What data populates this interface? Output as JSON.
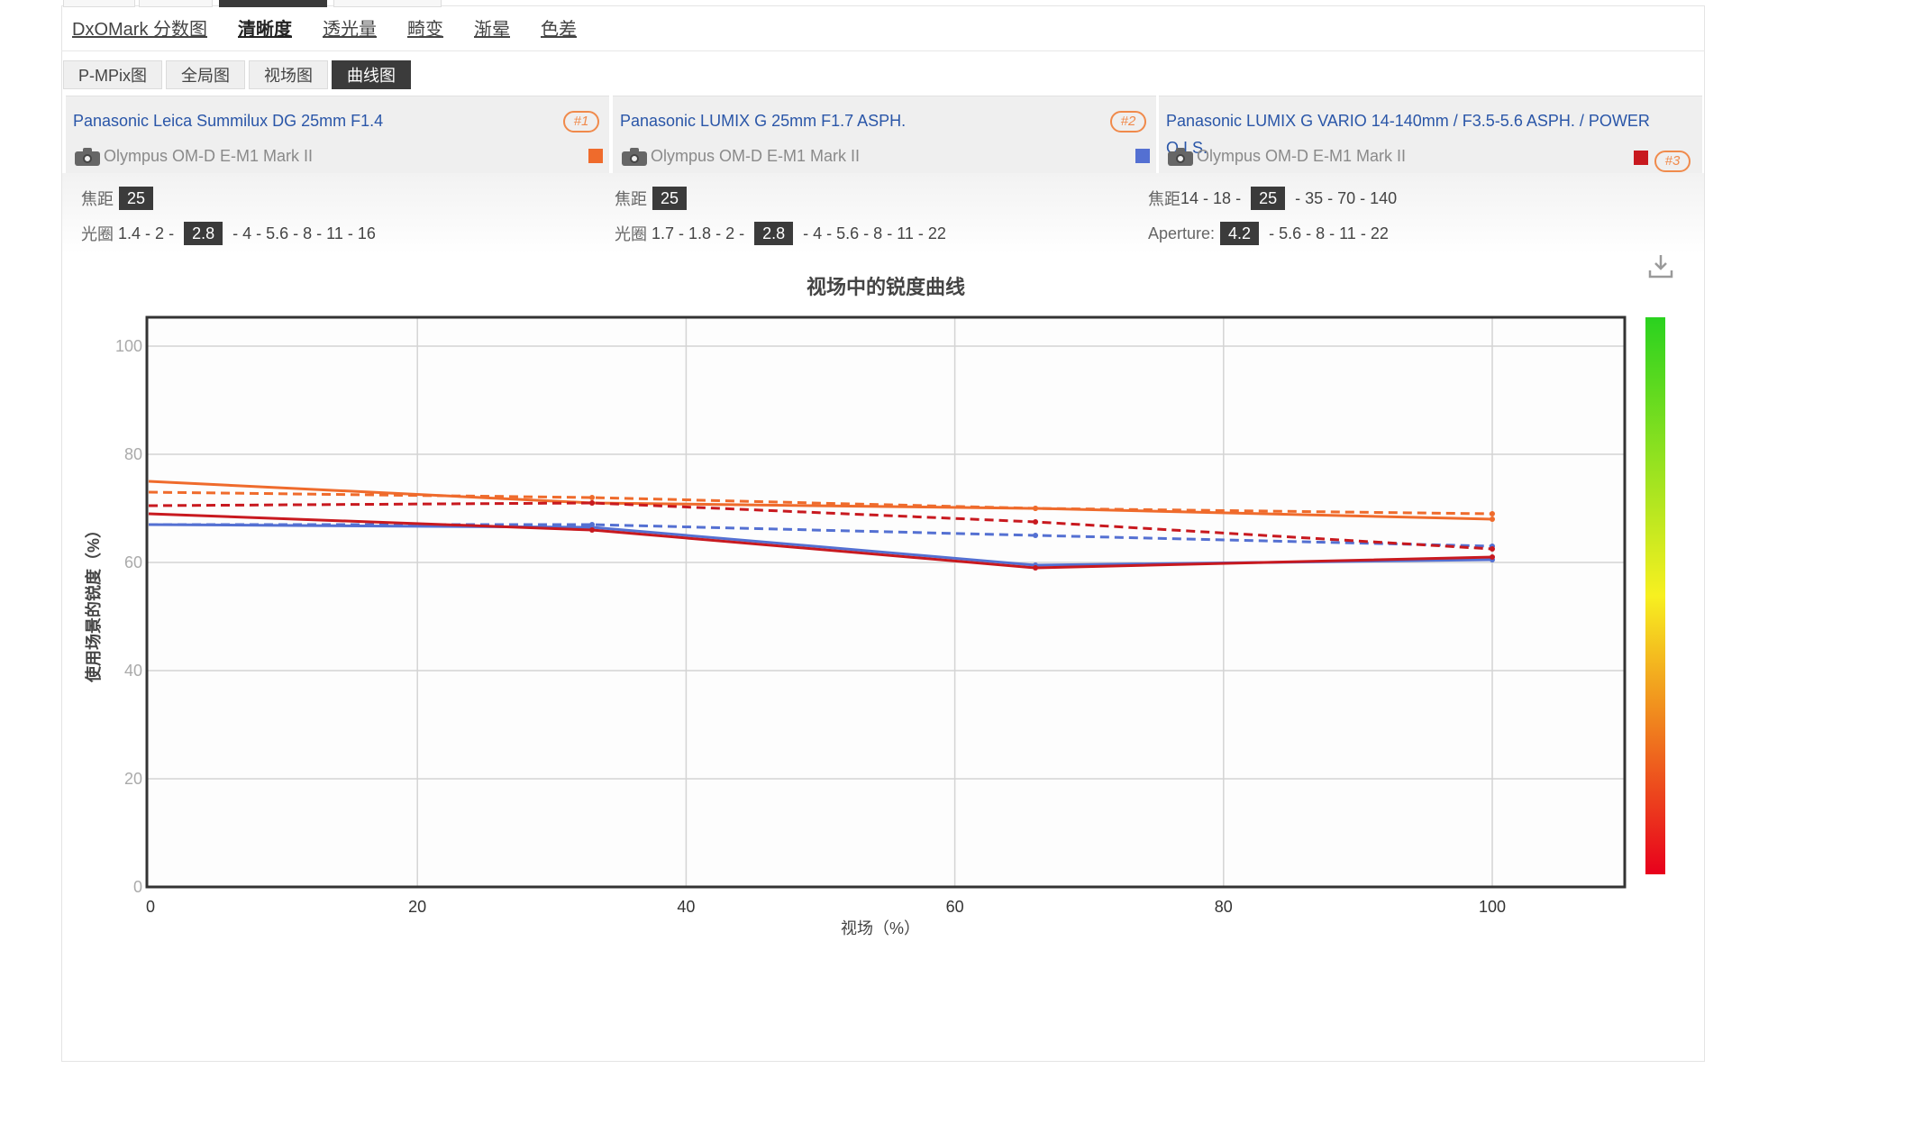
{
  "colors": {
    "accent": "#f08a4b",
    "link": "#2a56a8",
    "active_tab_bg": "#3b3b3b"
  },
  "tabs": [
    "DxOMark 分数图",
    "清晰度",
    "透光量",
    "畸变",
    "渐晕",
    "色差"
  ],
  "active_tab": "清晰度",
  "subtabs": [
    "P-MPix图",
    "全局图",
    "视场图",
    "曲线图"
  ],
  "active_subtab": "曲线图",
  "lenses": [
    {
      "name": "Panasonic Leica Summilux DG 25mm F1.4",
      "camera": "Olympus OM-D E-M1 Mark II",
      "rank": "#1",
      "color": "#ef6b2c",
      "icon": "camera-icon"
    },
    {
      "name": "Panasonic LUMIX G 25mm F1.7 ASPH.",
      "camera": "Olympus OM-D E-M1 Mark II",
      "rank": "#2",
      "color": "#5470d2",
      "icon": "camera-icon"
    },
    {
      "name": "Panasonic LUMIX G VARIO 14-140mm / F3.5-5.6 ASPH. / POWER O.I.S.",
      "camera": "Olympus OM-D E-M1 Mark II",
      "rank": "#3",
      "color": "#c8191f",
      "icon": "camera-icon"
    }
  ],
  "params": [
    {
      "focal": {
        "label": "焦距",
        "options": [
          "25"
        ],
        "selected": "25"
      },
      "aperture": {
        "label": "光圈",
        "options": [
          "1.4",
          "2",
          "2.8",
          "4",
          "5.6",
          "8",
          "11",
          "16"
        ],
        "selected": "2.8"
      }
    },
    {
      "focal": {
        "label": "焦距",
        "options": [
          "25"
        ],
        "selected": "25"
      },
      "aperture": {
        "label": "光圈",
        "options": [
          "1.7",
          "1.8",
          "2",
          "2.8",
          "4",
          "5.6",
          "8",
          "11",
          "22"
        ],
        "selected": "2.8"
      }
    },
    {
      "focal": {
        "label": "焦距",
        "options": [
          "14",
          "18",
          "25",
          "35",
          "70",
          "140"
        ],
        "selected": "25"
      },
      "aperture": {
        "label": "Aperture:",
        "options": [
          "4.2",
          "5.6",
          "8",
          "11",
          "22"
        ],
        "selected": "4.2"
      }
    }
  ],
  "download_icon": "download-icon",
  "chart_data": {
    "type": "line",
    "title": "视场中的锐度曲线",
    "xlabel": "视场（%）",
    "ylabel": "使用场景的锐度（%）",
    "xlim": [
      0,
      110
    ],
    "ylim": [
      0,
      105
    ],
    "x_ticks": [
      0,
      20,
      40,
      60,
      80,
      100
    ],
    "y_ticks": [
      0,
      20,
      40,
      60,
      80,
      100
    ],
    "grid": true,
    "colorbar": {
      "from": "#e8001c",
      "mid": "#f7f020",
      "to": "#2ad21f"
    },
    "series": [
      {
        "lens": 1,
        "style": "solid",
        "color": "#ef6b2c",
        "x": [
          0,
          33,
          66,
          100
        ],
        "y": [
          75,
          71,
          70,
          68
        ]
      },
      {
        "lens": 1,
        "style": "dashed",
        "color": "#ef6b2c",
        "x": [
          0,
          33,
          66,
          100
        ],
        "y": [
          73,
          72,
          70,
          69
        ]
      },
      {
        "lens": 2,
        "style": "solid",
        "color": "#5470d2",
        "x": [
          0,
          33,
          66,
          100
        ],
        "y": [
          67,
          66.5,
          59.5,
          60.5
        ]
      },
      {
        "lens": 2,
        "style": "dashed",
        "color": "#5470d2",
        "x": [
          0,
          33,
          66,
          100
        ],
        "y": [
          67,
          67,
          65,
          63
        ]
      },
      {
        "lens": 3,
        "style": "solid",
        "color": "#c8191f",
        "x": [
          0,
          33,
          66,
          100
        ],
        "y": [
          69,
          66,
          59,
          61
        ]
      },
      {
        "lens": 3,
        "style": "dashed",
        "color": "#c8191f",
        "x": [
          0,
          33,
          66,
          100
        ],
        "y": [
          70.5,
          71,
          67.5,
          62.5
        ]
      }
    ]
  }
}
